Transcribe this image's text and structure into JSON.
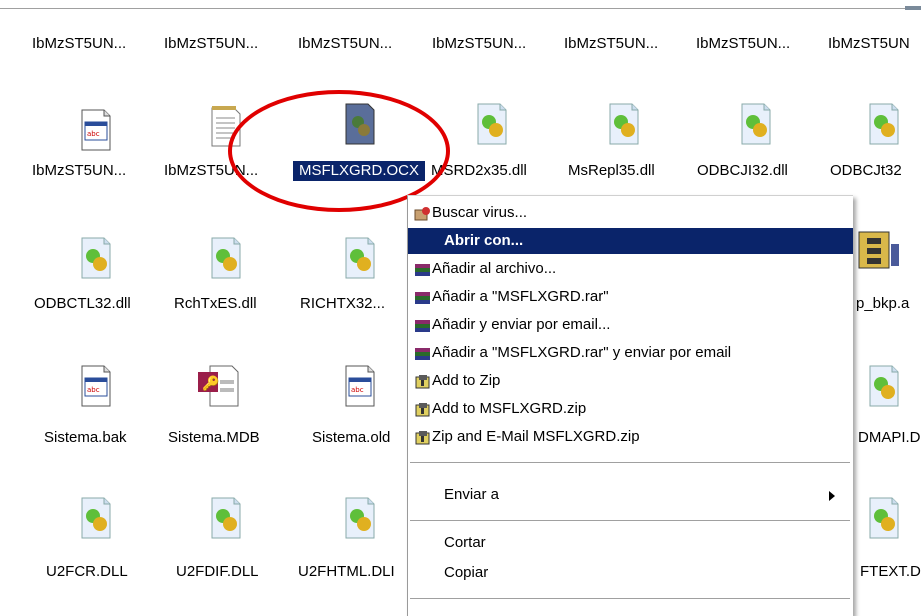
{
  "top_row_labels": [
    "IbMzST5UN...",
    "IbMzST5UN...",
    "IbMzST5UN...",
    "IbMzST5UN...",
    "IbMzST5UN...",
    "IbMzST5UN...",
    "IbMzST5UN"
  ],
  "row2": [
    "IbMzST5UN...",
    "IbMzST5UN...",
    "MSFLXGRD.OCX",
    "MSRD2x35.dll",
    "MsRepl35.dll",
    "ODBCJI32.dll",
    "ODBCJt32"
  ],
  "row3": [
    "ODBCTL32.dll",
    "RchTxES.dll",
    "RICHTX32...",
    "p_bkp.a"
  ],
  "row4": [
    "Sistema.bak",
    "Sistema.MDB",
    "Sistema.old",
    "DMAPI.D"
  ],
  "row5": [
    "U2FCR.DLL",
    "U2FDIF.DLL",
    "U2FHTML.DLI",
    "FTEXT.D"
  ],
  "selected_file": "MSFLXGRD.OCX",
  "context_menu": {
    "items": [
      "Buscar virus...",
      "Abrir con...",
      "Añadir al archivo...",
      "Añadir a \"MSFLXGRD.rar\"",
      "Añadir y enviar por email...",
      "Añadir a \"MSFLXGRD.rar\" y enviar por email",
      "Add to Zip",
      "Add to MSFLXGRD.zip",
      "Zip and E-Mail MSFLXGRD.zip",
      "Enviar a",
      "Cortar",
      "Copiar"
    ],
    "highlighted": "Abrir con..."
  },
  "colors": {
    "selection": "#0a246a",
    "highlight_circle": "#e00000"
  },
  "icons": {
    "window-file": "window-file-icon",
    "text-file": "notepad-icon",
    "dll": "dll-gear-icon",
    "access-db": "access-db-icon",
    "winrar": "winrar-books-icon",
    "zip": "zip-icon",
    "antivirus": "antivirus-icon",
    "archive": "archive-icon"
  }
}
